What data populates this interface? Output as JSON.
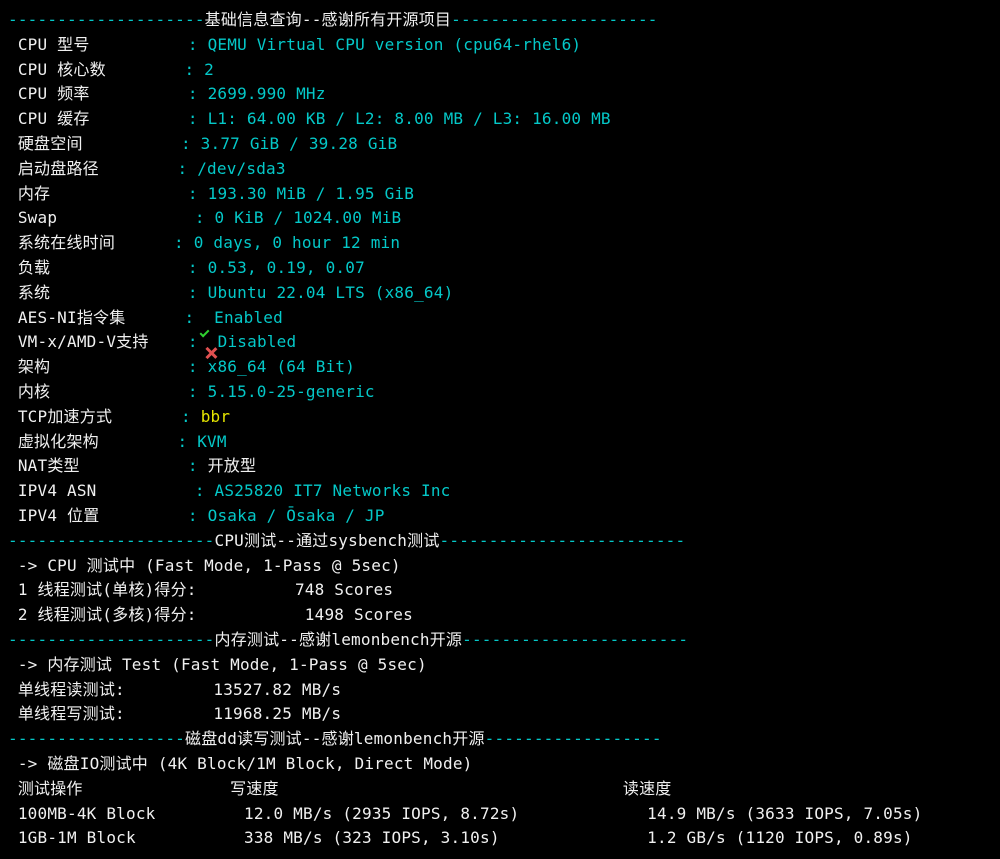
{
  "hdr1_left": "--------------------",
  "hdr1_mid": "基础信息查询--感谢所有开源项目",
  "hdr1_right": "---------------------",
  "colon": ":",
  "info": [
    {
      "label": "CPU 型号",
      "pad": "          ",
      "value": "QEMU Virtual CPU version (cpu64-rhel6)",
      "style": "cyan"
    },
    {
      "label": "CPU 核心数",
      "pad": "        ",
      "value": "2",
      "style": "cyan"
    },
    {
      "label": "CPU 频率",
      "pad": "          ",
      "value": "2699.990 MHz",
      "style": "cyan"
    },
    {
      "label": "CPU 缓存",
      "pad": "          ",
      "value": "L1: 64.00 KB / L2: 8.00 MB / L3: 16.00 MB",
      "style": "cyan"
    },
    {
      "label": "硬盘空间",
      "pad": "          ",
      "value": "3.77 GiB / 39.28 GiB",
      "style": "cyan"
    },
    {
      "label": "启动盘路径",
      "pad": "        ",
      "value": "/dev/sda3",
      "style": "cyan"
    },
    {
      "label": "内存",
      "pad": "              ",
      "value": "193.30 MiB / 1.95 GiB",
      "style": "cyan"
    },
    {
      "label": "Swap",
      "pad": "              ",
      "value": "0 KiB / 1024.00 MiB",
      "style": "cyan"
    },
    {
      "label": "系统在线时间",
      "pad": "      ",
      "value": "0 days, 0 hour 12 min",
      "style": "cyan"
    },
    {
      "label": "负载",
      "pad": "              ",
      "value": "0.53, 0.19, 0.07",
      "style": "cyan"
    },
    {
      "label": "系统",
      "pad": "              ",
      "value": "Ubuntu 22.04 LTS (x86_64)",
      "style": "cyan"
    },
    {
      "label": "AES-NI指令集",
      "pad": "      ",
      "value": "Enabled",
      "style": "cyan",
      "icon": "check"
    },
    {
      "label": "VM-x/AMD-V支持",
      "pad": "    ",
      "value": "Disabled",
      "style": "cyan",
      "icon": "cross"
    },
    {
      "label": "架构",
      "pad": "              ",
      "value": "x86_64 (64 Bit)",
      "style": "cyan"
    },
    {
      "label": "内核",
      "pad": "              ",
      "value": "5.15.0-25-generic",
      "style": "cyan"
    },
    {
      "label": "TCP加速方式",
      "pad": "       ",
      "value": "bbr",
      "style": "yellow"
    },
    {
      "label": "虚拟化架构",
      "pad": "        ",
      "value": "KVM",
      "style": "cyan"
    },
    {
      "label": "NAT类型",
      "pad": "           ",
      "value": "开放型",
      "style": "white"
    },
    {
      "label": "IPV4 ASN",
      "pad": "          ",
      "value": "AS25820 IT7 Networks Inc",
      "style": "cyan"
    },
    {
      "label": "IPV4 位置",
      "pad": "         ",
      "value": "Osaka / Ōsaka / JP",
      "style": "cyan"
    }
  ],
  "hdr2_left": "---------------------",
  "hdr2_mid": "CPU测试--通过sysbench测试",
  "hdr2_right": "-------------------------",
  "cpu_header": " -> CPU 测试中 (Fast Mode, 1-Pass @ 5sec)",
  "cpu1_label": " 1 线程测试(单核)得分:",
  "cpu1_value": "748 Scores",
  "cpu2_label": " 2 线程测试(多核)得分:",
  "cpu2_value": "1498 Scores",
  "cpu_pad": "          ",
  "hdr3_left": "---------------------",
  "hdr3_mid": "内存测试--感谢lemonbench开源",
  "hdr3_right": "-----------------------",
  "mem_header": " -> 内存测试 Test (Fast Mode, 1-Pass @ 5sec)",
  "mem1_label": " 单线程读测试:",
  "mem1_pad": "         ",
  "mem1_value": "13527.82 MB/s",
  "mem2_label": " 单线程写测试:",
  "mem2_pad": "         ",
  "mem2_value": "11968.25 MB/s",
  "hdr4_left": "------------------",
  "hdr4_mid": "磁盘dd读写测试--感谢lemonbench开源",
  "hdr4_right": "------------------",
  "dd_header": " -> 磁盘IO测试中 (4K Block/1M Block, Direct Mode)",
  "dd_col1": " 测试操作",
  "dd_col1_pad": "               ",
  "dd_col2": "写速度",
  "dd_col2_pad": "                                   ",
  "dd_col3": "读速度",
  "dd_rows": [
    {
      "c1": " 100MB-4K Block",
      "p1": "         ",
      "c2": "12.0 MB/s (2935 IOPS, 8.72s)",
      "p2": "             ",
      "c3": "14.9 MB/s (3633 IOPS, 7.05s)"
    },
    {
      "c1": " 1GB-1M Block",
      "p1": "           ",
      "c2": "338 MB/s (323 IOPS, 3.10s)",
      "p2": "               ",
      "c3": "1.2 GB/s (1120 IOPS, 0.89s)"
    }
  ]
}
